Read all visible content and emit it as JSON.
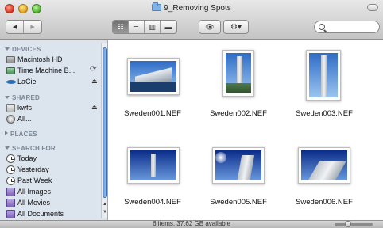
{
  "window": {
    "title": "9_Removing Spots"
  },
  "toolbar": {
    "back_glyph": "◀",
    "forward_glyph": "▶",
    "view_icon_glyph": "☷",
    "view_list_glyph": "≡",
    "view_columns_glyph": "▥",
    "view_coverflow_glyph": "▬",
    "quicklook_glyph": "👁",
    "action_glyph": "⚙▾",
    "search_value": ""
  },
  "sidebar": {
    "sections": {
      "devices": "DEVICES",
      "shared": "SHARED",
      "places": "PLACES",
      "search_for": "SEARCH FOR"
    },
    "devices": [
      {
        "label": "Macintosh HD",
        "icon": "hard-drive-icon"
      },
      {
        "label": "Time Machine B...",
        "icon": "time-machine-drive-icon"
      },
      {
        "label": "LaCie",
        "icon": "external-drive-icon"
      }
    ],
    "shared": [
      {
        "label": "kwfs",
        "icon": "shared-host-icon"
      },
      {
        "label": "All...",
        "icon": "network-icon"
      }
    ],
    "search_for": [
      {
        "label": "Today",
        "icon": "clock-icon"
      },
      {
        "label": "Yesterday",
        "icon": "clock-icon"
      },
      {
        "label": "Past Week",
        "icon": "clock-icon"
      },
      {
        "label": "All Images",
        "icon": "smart-folder-icon"
      },
      {
        "label": "All Movies",
        "icon": "smart-folder-icon"
      },
      {
        "label": "All Documents",
        "icon": "smart-folder-icon"
      }
    ],
    "eject_glyph": "⏏",
    "sync_glyph": "⟳"
  },
  "files": [
    {
      "name": "Sweden001.NEF"
    },
    {
      "name": "Sweden002.NEF"
    },
    {
      "name": "Sweden003.NEF"
    },
    {
      "name": "Sweden004.NEF"
    },
    {
      "name": "Sweden005.NEF"
    },
    {
      "name": "Sweden006.NEF"
    }
  ],
  "status": {
    "text": "6 items, 37.62 GB available",
    "zoom_level": 0.35
  },
  "colors": {
    "sidebar_bg": "#dce4ee",
    "selected_view": "#7a7a7a"
  }
}
